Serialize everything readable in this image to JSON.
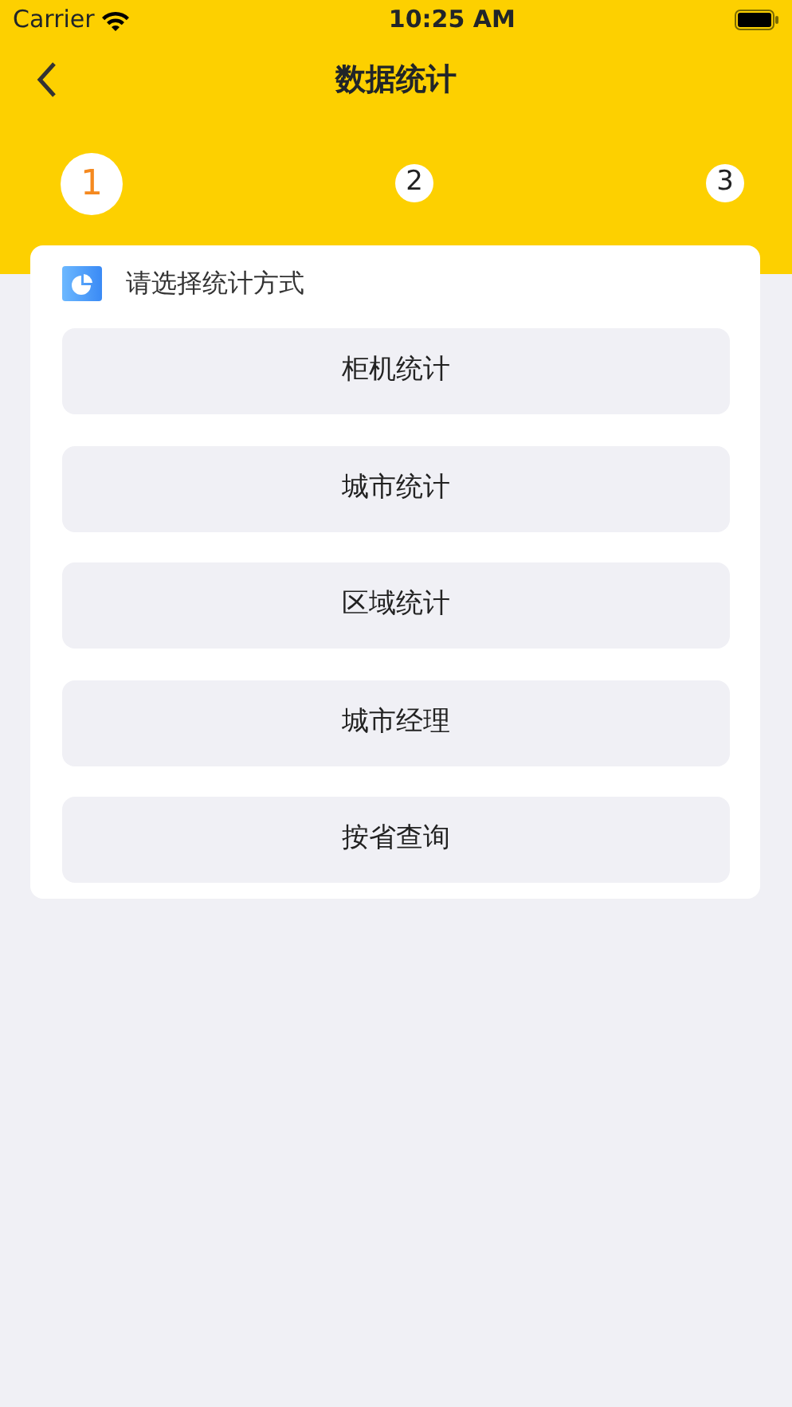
{
  "status_bar": {
    "carrier": "Carrier",
    "time": "10:25 AM"
  },
  "nav": {
    "title": "数据统计"
  },
  "steps": [
    {
      "label": "1",
      "selected": true
    },
    {
      "label": "2",
      "selected": false
    },
    {
      "label": "3",
      "selected": false
    }
  ],
  "card": {
    "heading": "请选择统计方式",
    "options": [
      "柜机统计",
      "城市统计",
      "区域统计",
      "城市经理",
      "按省查询"
    ]
  }
}
